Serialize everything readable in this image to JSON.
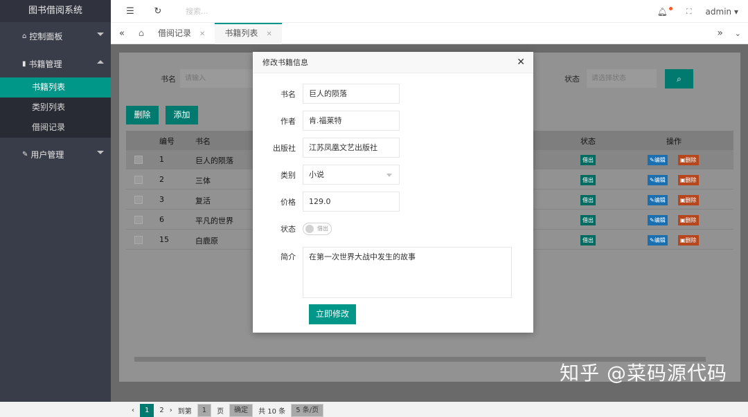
{
  "sidebar": {
    "logo": "图书借阅系统",
    "items": [
      {
        "label": "控制面板",
        "icon": "home-icon"
      },
      {
        "label": "书籍管理",
        "icon": "book-icon",
        "children": [
          "书籍列表",
          "类别列表",
          "借阅记录"
        ]
      },
      {
        "label": "用户管理",
        "icon": "pencil-icon"
      }
    ]
  },
  "topbar": {
    "search_placeholder": "搜索...",
    "user": "admin"
  },
  "tabs": [
    {
      "label": "借阅记录"
    },
    {
      "label": "书籍列表"
    }
  ],
  "filters": {
    "name_label": "书名",
    "name_placeholder": "请输入",
    "status_label": "状态",
    "status_placeholder": "请选择状态"
  },
  "actions": {
    "delete": "删除",
    "add": "添加"
  },
  "table": {
    "headers": [
      "编号",
      "书名",
      "状态",
      "操作"
    ],
    "rows": [
      {
        "id": "1",
        "name": "巨人的陨落",
        "status": "借出"
      },
      {
        "id": "2",
        "name": "三体",
        "status": "借出"
      },
      {
        "id": "3",
        "name": "复活",
        "status": "借出"
      },
      {
        "id": "6",
        "name": "平凡的世界",
        "status": "借出"
      },
      {
        "id": "15",
        "name": "白鹿原",
        "status": "借出"
      }
    ],
    "edit_label": "编辑",
    "delete_label": "删除"
  },
  "pager": {
    "current": "1",
    "next": "2",
    "goto_label": "到第",
    "goto_value": "1",
    "page_unit": "页",
    "confirm": "确定",
    "total": "共 10 条",
    "page_size": "5 条/页"
  },
  "modal": {
    "title": "修改书籍信息",
    "fields": {
      "name_label": "书名",
      "name_value": "巨人的陨落",
      "author_label": "作者",
      "author_value": "肯.福莱特",
      "publisher_label": "出版社",
      "publisher_value": "江苏凤凰文艺出版社",
      "category_label": "类别",
      "category_value": "小说",
      "price_label": "价格",
      "price_value": "129.0",
      "status_label": "状态",
      "status_value": "借出",
      "intro_label": "简介",
      "intro_value": "在第一次世界大战中发生的故事"
    },
    "submit": "立即修改"
  },
  "watermark": "知乎 @菜码源代码",
  "colors": {
    "accent": "#009688",
    "sidebar": "#393d49",
    "danger": "#ff5722",
    "info": "#1e9fff"
  }
}
